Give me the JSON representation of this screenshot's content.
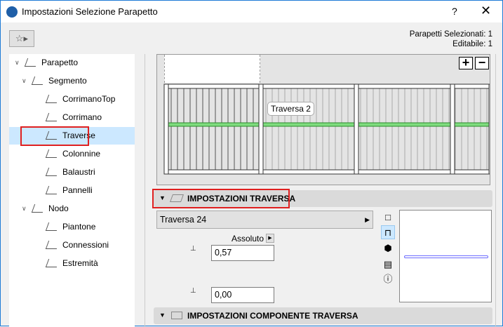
{
  "window": {
    "title": "Impostazioni Selezione Parapetto",
    "help": "?",
    "close": "✕"
  },
  "info": {
    "selected": "Parapetti Selezionati: 1",
    "editable": "Editabile: 1"
  },
  "tree": [
    {
      "label": "Parapetto",
      "level": 0,
      "expanded": true
    },
    {
      "label": "Segmento",
      "level": 1,
      "expanded": true
    },
    {
      "label": "CorrimanoTop",
      "level": 2
    },
    {
      "label": "Corrimano",
      "level": 2
    },
    {
      "label": "Traverse",
      "level": 2,
      "selected": true
    },
    {
      "label": "Colonnine",
      "level": 2
    },
    {
      "label": "Balaustri",
      "level": 2
    },
    {
      "label": "Pannelli",
      "level": 2
    },
    {
      "label": "Nodo",
      "level": 1,
      "expanded": true
    },
    {
      "label": "Piantone",
      "level": 2
    },
    {
      "label": "Connessioni",
      "level": 2
    },
    {
      "label": "Estremità",
      "level": 2
    }
  ],
  "preview": {
    "tooltip": "Traversa 2",
    "zoom_in": "+",
    "zoom_out": "−"
  },
  "section1": {
    "title": "IMPOSTAZIONI TRAVERSA",
    "profile": "Traversa 24",
    "mode": "Assoluto",
    "height": "0,57",
    "offset": "0,00"
  },
  "section2": {
    "title": "IMPOSTAZIONI COMPONENTE TRAVERSA"
  },
  "colors": {
    "accent_rail": "#7fdc7f",
    "selection": "#cce8ff",
    "highlight_border": "#e02020"
  }
}
